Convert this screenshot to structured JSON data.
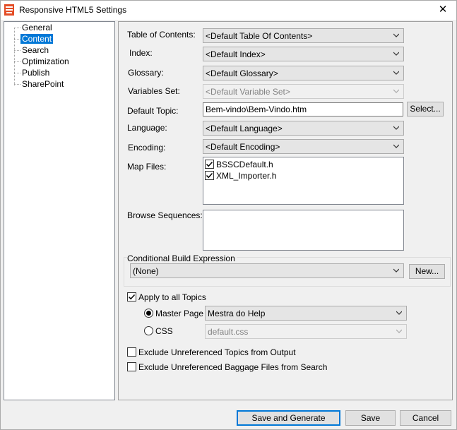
{
  "window": {
    "title": "Responsive HTML5 Settings",
    "close_glyph": "✕"
  },
  "tree": {
    "items": [
      {
        "label": "General",
        "selected": false
      },
      {
        "label": "Content",
        "selected": true
      },
      {
        "label": "Search",
        "selected": false
      },
      {
        "label": "Optimization",
        "selected": false
      },
      {
        "label": "Publish",
        "selected": false
      },
      {
        "label": "SharePoint",
        "selected": false
      }
    ]
  },
  "content": {
    "toc_label": "Table of Contents:",
    "toc_value": "<Default Table Of Contents>",
    "index_label": "Index:",
    "index_value": "<Default Index>",
    "glossary_label": "Glossary:",
    "glossary_value": "<Default Glossary>",
    "variables_label": "Variables Set:",
    "variables_value": "<Default Variable Set>",
    "default_topic_label": "Default Topic:",
    "default_topic_value": "Bem-vindo\\Bem-Vindo.htm",
    "select_button": "Select...",
    "language_label": "Language:",
    "language_value": "<Default Language>",
    "encoding_label": "Encoding:",
    "encoding_value": "<Default Encoding>",
    "map_files_label": "Map Files:",
    "map_files": [
      {
        "name": "BSSCDefault.h",
        "checked": true
      },
      {
        "name": "XML_Importer.h",
        "checked": true
      }
    ],
    "browse_label": "Browse Sequences:",
    "cbe_label": "Conditional Build Expression",
    "cbe_value": "(None)",
    "new_button": "New...",
    "apply_all_label": "Apply to all Topics",
    "master_page_label": "Master Page",
    "master_page_value": "Mestra do Help",
    "css_label": "CSS",
    "css_value": "default.css",
    "exclude_topics_label": "Exclude Unreferenced Topics from Output",
    "exclude_baggage_label": "Exclude Unreferenced Baggage Files from Search"
  },
  "footer": {
    "save_generate": "Save and Generate",
    "save": "Save",
    "cancel": "Cancel"
  },
  "colors": {
    "accent": "#0078d7",
    "icon": "#e44d26"
  }
}
